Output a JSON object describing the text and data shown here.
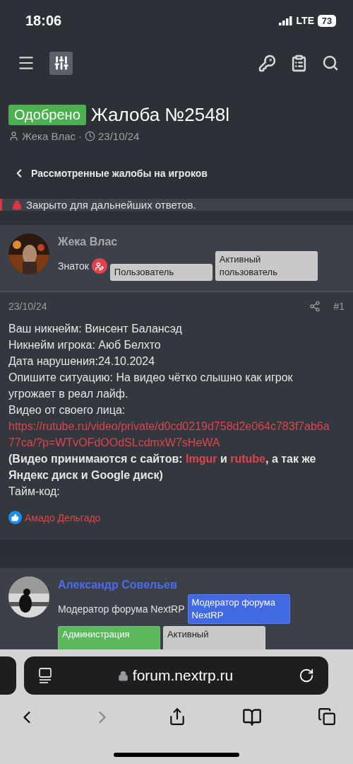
{
  "status_bar": {
    "time": "18:06",
    "network": "LTE",
    "battery": "73"
  },
  "thread": {
    "status_badge": "Одобрено",
    "title": "Жалоба №2548l",
    "author": "Жека Влас",
    "separator": "·",
    "date": "23/10/24"
  },
  "breadcrumb": "Рассмотренные жалобы на игроков",
  "notice": "Закрыто для дальнейших ответов.",
  "posts": [
    {
      "author": "Жека Влас",
      "color": "#a9a9a9",
      "role": "Знаток",
      "role_icon": true,
      "badges": [
        {
          "label": "Пользователь",
          "color": "#c8c8c8"
        },
        {
          "label": "Активный пользователь",
          "color": "#c8c8c8"
        }
      ],
      "date": "23/10/24",
      "number": "#1",
      "body": [
        {
          "kind": "text",
          "text": "Ваш никнейм: Винсент Балансэд"
        },
        {
          "kind": "text",
          "text": "Никнейм игрока: Аюб Белхто"
        },
        {
          "kind": "text",
          "text": "Дата нарушения:24.10.2024"
        },
        {
          "kind": "text",
          "text": "Опишите ситуацию: На видео чётко слышно как игрок угрожает в реал лайф."
        },
        {
          "kind": "text",
          "text": "Видео от своего лица:"
        },
        {
          "kind": "link",
          "text": "https://rutube.ru/video/private/d0cd0219d758d2e064c783f7ab6a77ca/?p=WTvOFdOOdSLcdmxW7sHeWA"
        },
        {
          "kind": "mixed",
          "bold": true,
          "parts": [
            {
              "kind": "text",
              "text": "(Видео принимаются с сайтов: "
            },
            {
              "kind": "link",
              "text": "Imgur"
            },
            {
              "kind": "text",
              "text": " и "
            },
            {
              "kind": "link",
              "text": "rutube"
            },
            {
              "kind": "text",
              "text": ", а так же Яндекс диск и Google диск)"
            }
          ]
        },
        {
          "kind": "text",
          "text": "Тайм-код:"
        }
      ],
      "likes": "Амадо Дельгадо"
    },
    {
      "author": "Александр Совельев",
      "color": "#4a6cf0",
      "role": "Модератор форума NextRP",
      "role_icon": false,
      "badges": [
        {
          "label": "Модератор форума NextRP",
          "color": "#4169e1"
        },
        {
          "label": "Администрация",
          "color": "#5cb85c"
        },
        {
          "label": "Активный",
          "color": "#c8c8c8"
        }
      ]
    }
  ],
  "browser": {
    "address": "forum.nextrp.ru"
  }
}
